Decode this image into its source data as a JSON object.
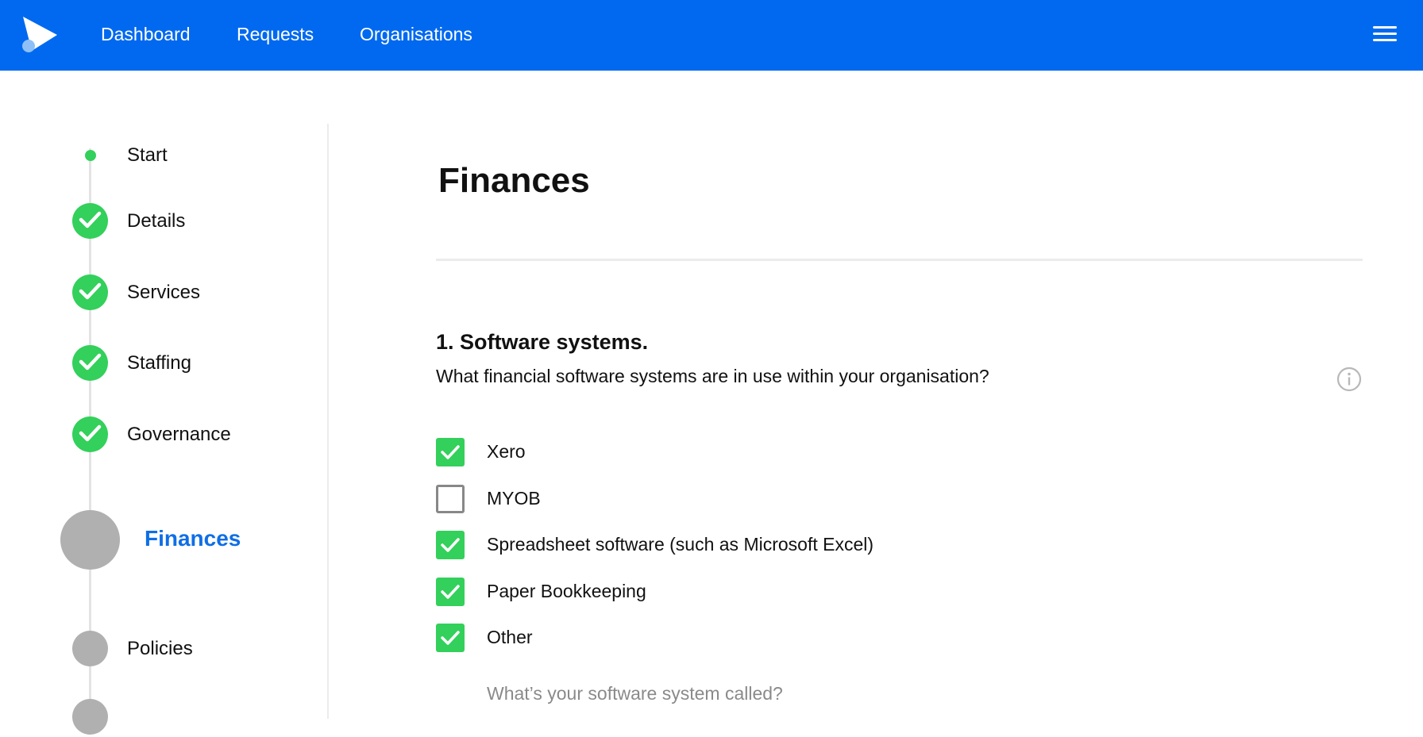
{
  "nav": {
    "links": [
      "Dashboard",
      "Requests",
      "Organisations"
    ]
  },
  "colors": {
    "brand": "#0169f0",
    "success": "#33d05b",
    "pending": "#b0b0b0",
    "current_label": "#0f6ee6"
  },
  "stepper": {
    "steps": [
      {
        "label": "Start",
        "state": "started"
      },
      {
        "label": "Details",
        "state": "done"
      },
      {
        "label": "Services",
        "state": "done"
      },
      {
        "label": "Staffing",
        "state": "done"
      },
      {
        "label": "Governance",
        "state": "done"
      },
      {
        "label": "Finances",
        "state": "current"
      },
      {
        "label": "Policies",
        "state": "pending"
      }
    ]
  },
  "main": {
    "title": "Finances",
    "question": {
      "heading": "1. Software systems.",
      "text": "What financial software systems are in use within your organisation?",
      "options": [
        {
          "label": "Xero",
          "checked": true
        },
        {
          "label": "MYOB",
          "checked": false
        },
        {
          "label": "Spreadsheet software (such as Microsoft Excel)",
          "checked": true
        },
        {
          "label": "Paper Bookkeeping",
          "checked": true
        },
        {
          "label": "Other",
          "checked": true
        }
      ],
      "followup_label": "What’s your software system called?"
    }
  }
}
